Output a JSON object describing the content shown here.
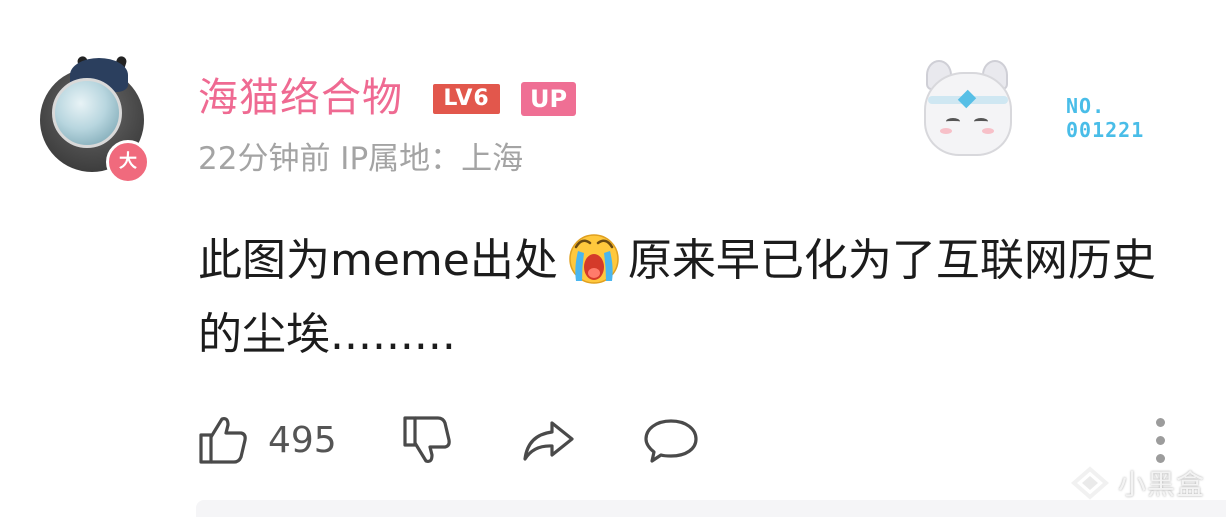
{
  "comment": {
    "username": "海猫络合物",
    "level_badge": "LV6",
    "role_badge": "UP",
    "avatar_badge": "大",
    "time_location": "22分钟前 IP属地：上海",
    "decoration_label_line1": "NO.",
    "decoration_label_line2": "001221",
    "body_part1": "此图为meme出处",
    "body_emoji": "crying-face-emoji",
    "body_part2": "原来早已化为了互联网历史的尘埃.........",
    "like_count": "495"
  },
  "watermark": {
    "text": "小黑盒"
  },
  "colors": {
    "username": "#ef6a92",
    "level_badge": "#e2574c",
    "role_badge": "#ef6f94",
    "meta_text": "#a4a4a4",
    "decoration_label": "#49bde8",
    "icon_stroke": "#4a4a4a"
  },
  "icons": {
    "like": "thumbs-up-icon",
    "dislike": "thumbs-down-icon",
    "share": "share-arrow-icon",
    "reply": "comment-bubble-icon",
    "more": "more-vertical-icon"
  }
}
